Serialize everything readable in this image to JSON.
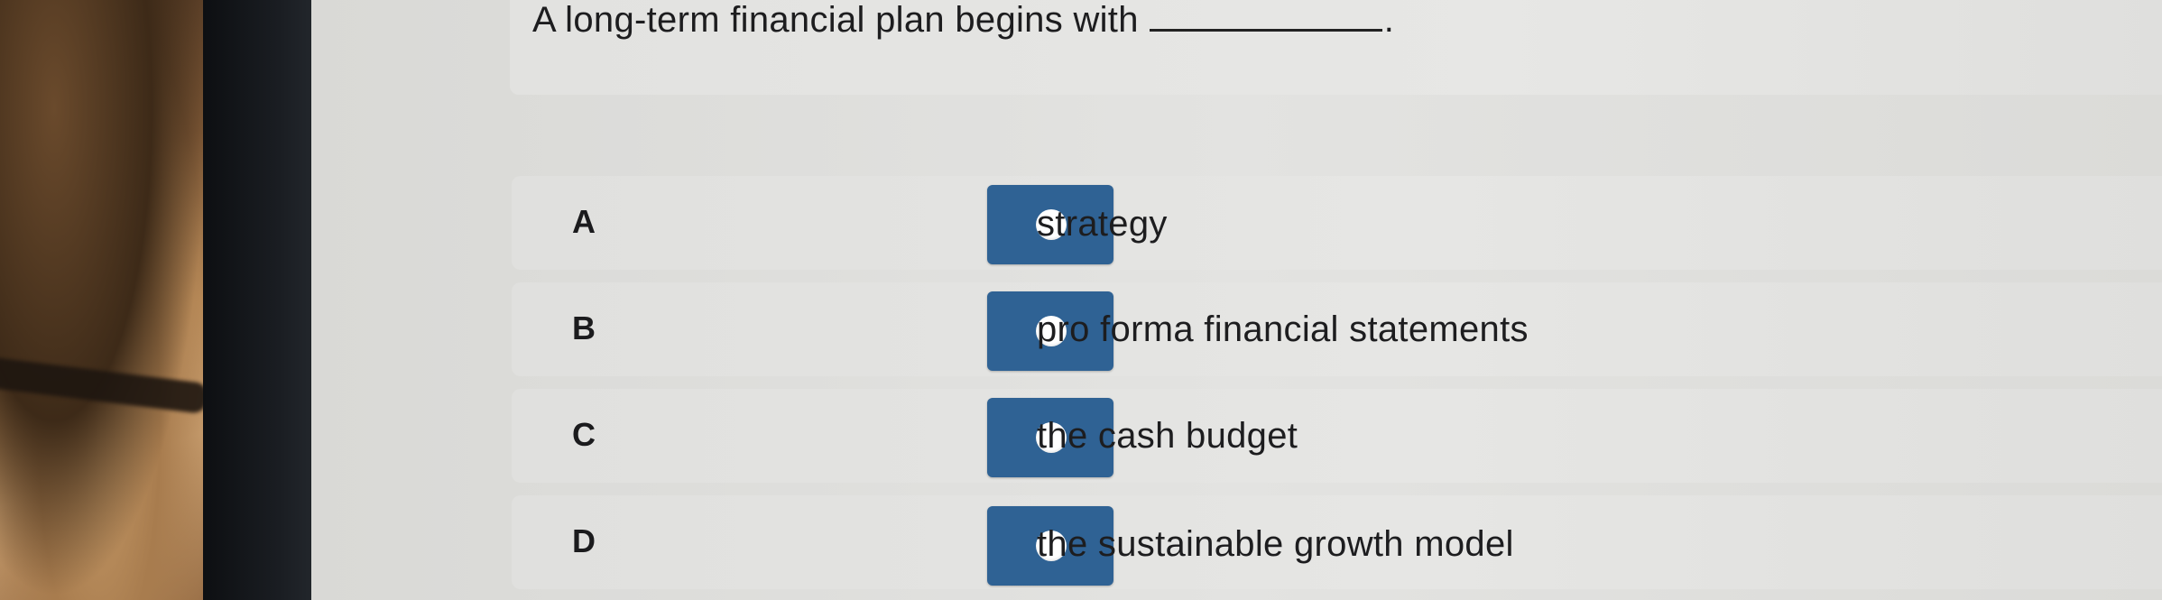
{
  "question": {
    "text": "A long-term financial plan begins with",
    "end_punct": "."
  },
  "options": [
    {
      "letter": "A",
      "text": "strategy"
    },
    {
      "letter": "B",
      "text": "pro forma financial statements"
    },
    {
      "letter": "C",
      "text": "the cash budget"
    },
    {
      "letter": "D",
      "text": "the sustainable growth model"
    }
  ],
  "colors": {
    "radio_fill": "#2f6294",
    "radio_dot": "#ffffff",
    "text": "#1d1d1f"
  }
}
